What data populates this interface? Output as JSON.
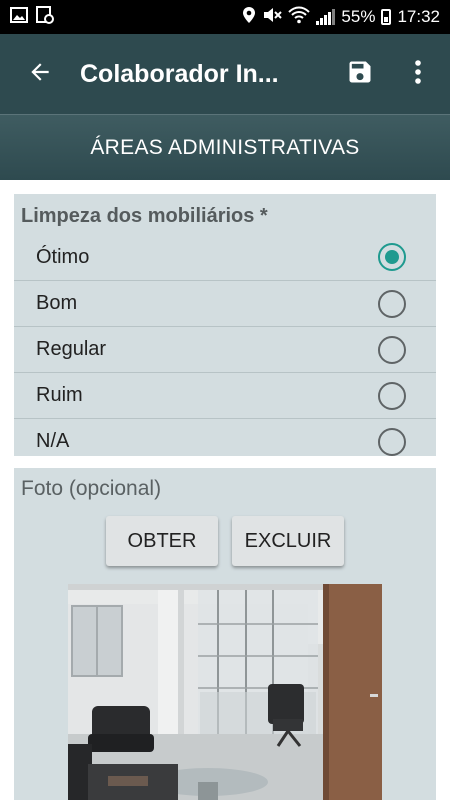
{
  "status_bar": {
    "battery": "55%",
    "time": "17:32"
  },
  "app_bar": {
    "title": "Colaborador In...",
    "icons": {
      "back": "arrow-left-icon",
      "save": "save-icon",
      "more": "more-vert-icon"
    }
  },
  "section": {
    "title": "ÁREAS ADMINISTRATIVAS"
  },
  "question": {
    "label": "Limpeza dos mobiliários *",
    "options": [
      {
        "label": "Ótimo",
        "selected": true
      },
      {
        "label": "Bom",
        "selected": false
      },
      {
        "label": "Regular",
        "selected": false
      },
      {
        "label": "Ruim",
        "selected": false
      },
      {
        "label": "N/A",
        "selected": false
      }
    ]
  },
  "photo": {
    "label": "Foto (opcional)",
    "obter_label": "OBTER",
    "excluir_label": "EXCLUIR"
  },
  "colors": {
    "app_bar": "#2e4a4f",
    "card_bg": "#d3dde0",
    "accent": "#1f9a8f"
  }
}
